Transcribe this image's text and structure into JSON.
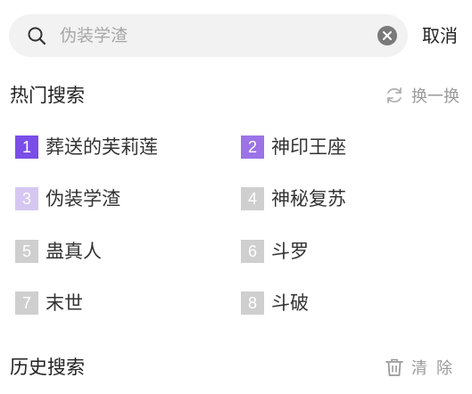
{
  "search": {
    "placeholder": "伪装学渣",
    "value": ""
  },
  "header": {
    "cancel_label": "取消"
  },
  "hot_search": {
    "title": "热门搜索",
    "refresh_label": "换一换",
    "items": [
      {
        "rank": "1",
        "label": "葬送的芙莉莲",
        "badge_color": "#7b4de8"
      },
      {
        "rank": "2",
        "label": "神印王座",
        "badge_color": "#9b73e6"
      },
      {
        "rank": "3",
        "label": "伪装学渣",
        "badge_color": "#d6c7f2"
      },
      {
        "rank": "4",
        "label": "神秘复苏",
        "badge_color": "#cfcfcf"
      },
      {
        "rank": "5",
        "label": "蛊真人",
        "badge_color": "#cfcfcf"
      },
      {
        "rank": "6",
        "label": "斗罗",
        "badge_color": "#cfcfcf"
      },
      {
        "rank": "7",
        "label": "末世",
        "badge_color": "#cfcfcf"
      },
      {
        "rank": "8",
        "label": "斗破",
        "badge_color": "#cfcfcf"
      }
    ]
  },
  "history": {
    "title": "历史搜索",
    "clear_label": "清除"
  },
  "icons": {
    "search": "search-icon",
    "clear": "clear-input-icon",
    "refresh": "refresh-icon",
    "trash": "trash-icon"
  }
}
